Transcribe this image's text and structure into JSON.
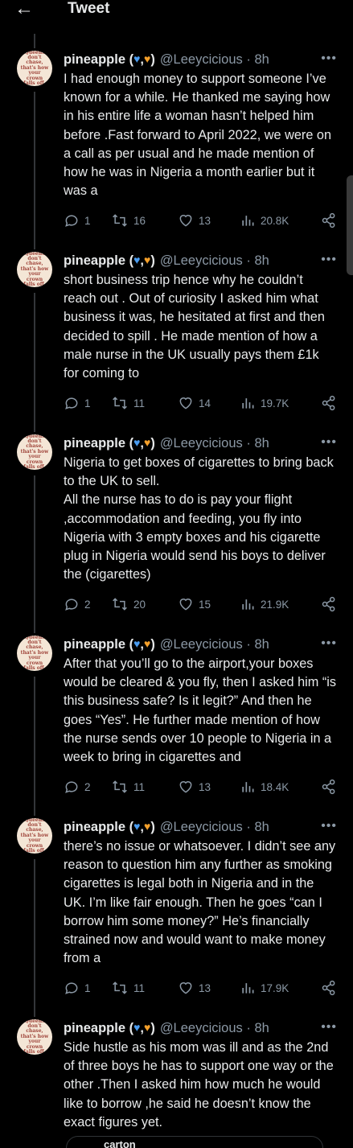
{
  "header": {
    "title": "Tweet",
    "back_icon": "arrow-left-icon"
  },
  "author": {
    "name": "pineapple (",
    "hearts": [
      "♥",
      ",",
      "♥"
    ],
    "name_end": ")",
    "handle": "@Leeycicious · 8h",
    "avatar_text": "Queens don't chase, that's how your crown falls off."
  },
  "more_label": "•••",
  "tweets": [
    {
      "text": "I had enough money to support someone I’ve known for a while. He thanked me saying how in his entire life a woman hasn’t helped him before .Fast forward to April 2022, we were on a call as per usual and he made mention of how he was in Nigeria a month earlier but it was a",
      "replies": "1",
      "retweets": "16",
      "likes": "13",
      "views": "20.8K"
    },
    {
      "text": "short business trip hence why he couldn’t reach out . Out of curiosity I asked him what business it was, he hesitated at first and then decided to spill . He made mention of how a male nurse in the UK usually pays them £1k for coming to",
      "replies": "1",
      "retweets": "11",
      "likes": "14",
      "views": "19.7K"
    },
    {
      "text": "Nigeria to get boxes of cigarettes to bring back to the UK to sell.\nAll the nurse has to do is pay your flight ,accommodation and feeding, you fly into Nigeria with 3 empty boxes and his cigarette plug in Nigeria would  send his boys to deliver the (cigarettes)",
      "replies": "2",
      "retweets": "20",
      "likes": "15",
      "views": "21.9K"
    },
    {
      "text": "After that you’ll go to the airport,your boxes would be cleared & you fly, then I asked him “is this business safe? Is it legit?” And then he goes “Yes”. He further made mention of how the nurse sends over 10 people to Nigeria in a week to bring in cigarettes and",
      "replies": "2",
      "retweets": "11",
      "likes": "13",
      "views": "18.4K"
    },
    {
      "text": "there’s no issue or whatsoever. I didn’t see any reason to question him any further as smoking cigarettes is legal both in Nigeria and in the UK. I’m like fair enough. Then he goes “can I borrow him some money?” He’s financially strained now and would want to make money from a",
      "replies": "1",
      "retweets": "11",
      "likes": "13",
      "views": "17.9K"
    },
    {
      "text": "Side hustle as his mom was ill and as the 2nd of three boys he has to support one way or the other .Then I asked him how much he would like to borrow ,he said he doesn’t know the exact figures yet."
    }
  ],
  "bottom_bubble_text": "carton",
  "colors": {
    "blue_heart": "#4a9cf0",
    "orange_heart": "#f5a02a",
    "muted": "#8b98a5"
  }
}
